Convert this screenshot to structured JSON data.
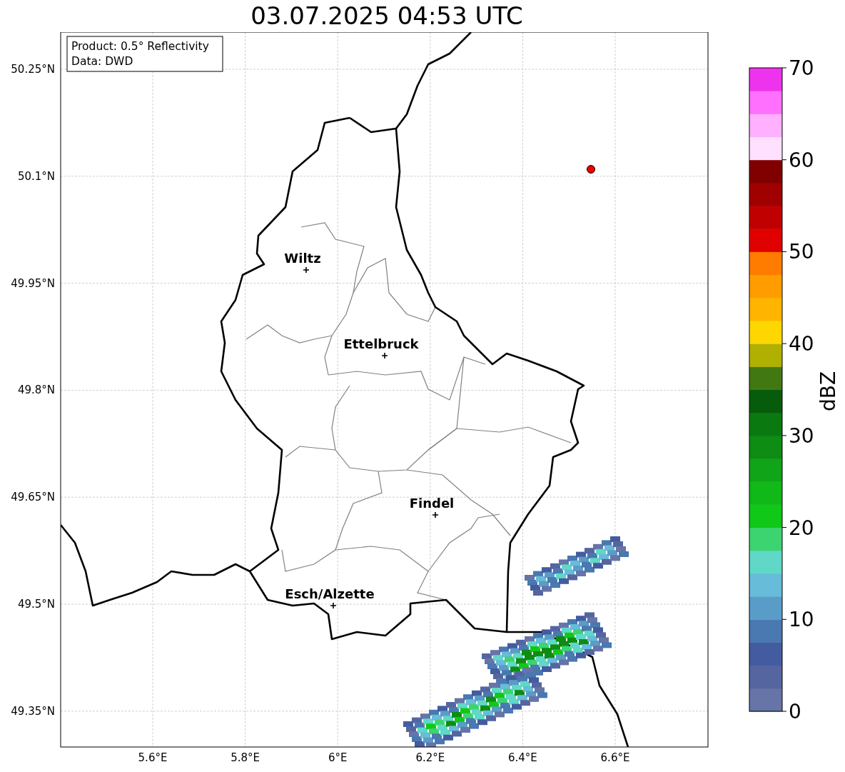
{
  "title": "03.07.2025 04:53 UTC",
  "info": [
    "Product: 0.5° Reflectivity",
    "Data: DWD"
  ],
  "yticks": [
    "50.25°N",
    "50.1°N",
    "49.95°N",
    "49.8°N",
    "49.65°N",
    "49.5°N",
    "49.35°N"
  ],
  "xticks": [
    "5.6°E",
    "5.8°E",
    "6°E",
    "6.2°E",
    "6.4°E",
    "6.6°E"
  ],
  "cities": [
    {
      "name": "Wiltz"
    },
    {
      "name": "Ettelbruck"
    },
    {
      "name": "Findel"
    },
    {
      "name": "Esch/Alzette"
    }
  ],
  "colorbar": {
    "label": "dBZ",
    "ticks": [
      "70",
      "60",
      "50",
      "40",
      "30",
      "20",
      "10",
      "0"
    ],
    "bins": [
      {
        "color": "#6674a8"
      },
      {
        "color": "#5565a0"
      },
      {
        "color": "#435ca0"
      },
      {
        "color": "#4a78b0"
      },
      {
        "color": "#5a9cc8"
      },
      {
        "color": "#66bcd9"
      },
      {
        "color": "#60d8c8"
      },
      {
        "color": "#3cd470"
      },
      {
        "color": "#10c818"
      },
      {
        "color": "#10b818"
      },
      {
        "color": "#10a418"
      },
      {
        "color": "#0e8c14"
      },
      {
        "color": "#0a7a10"
      },
      {
        "color": "#065c0a"
      },
      {
        "color": "#427812"
      },
      {
        "color": "#b0b000"
      },
      {
        "color": "#ffd700"
      },
      {
        "color": "#ffb400"
      },
      {
        "color": "#ff9c00"
      },
      {
        "color": "#ff7c00"
      },
      {
        "color": "#e00000"
      },
      {
        "color": "#c00000"
      },
      {
        "color": "#a00000"
      },
      {
        "color": "#800000"
      },
      {
        "color": "#ffe0ff"
      },
      {
        "color": "#ffb0ff"
      },
      {
        "color": "#ff70ff"
      },
      {
        "color": "#ee33ee"
      }
    ]
  }
}
